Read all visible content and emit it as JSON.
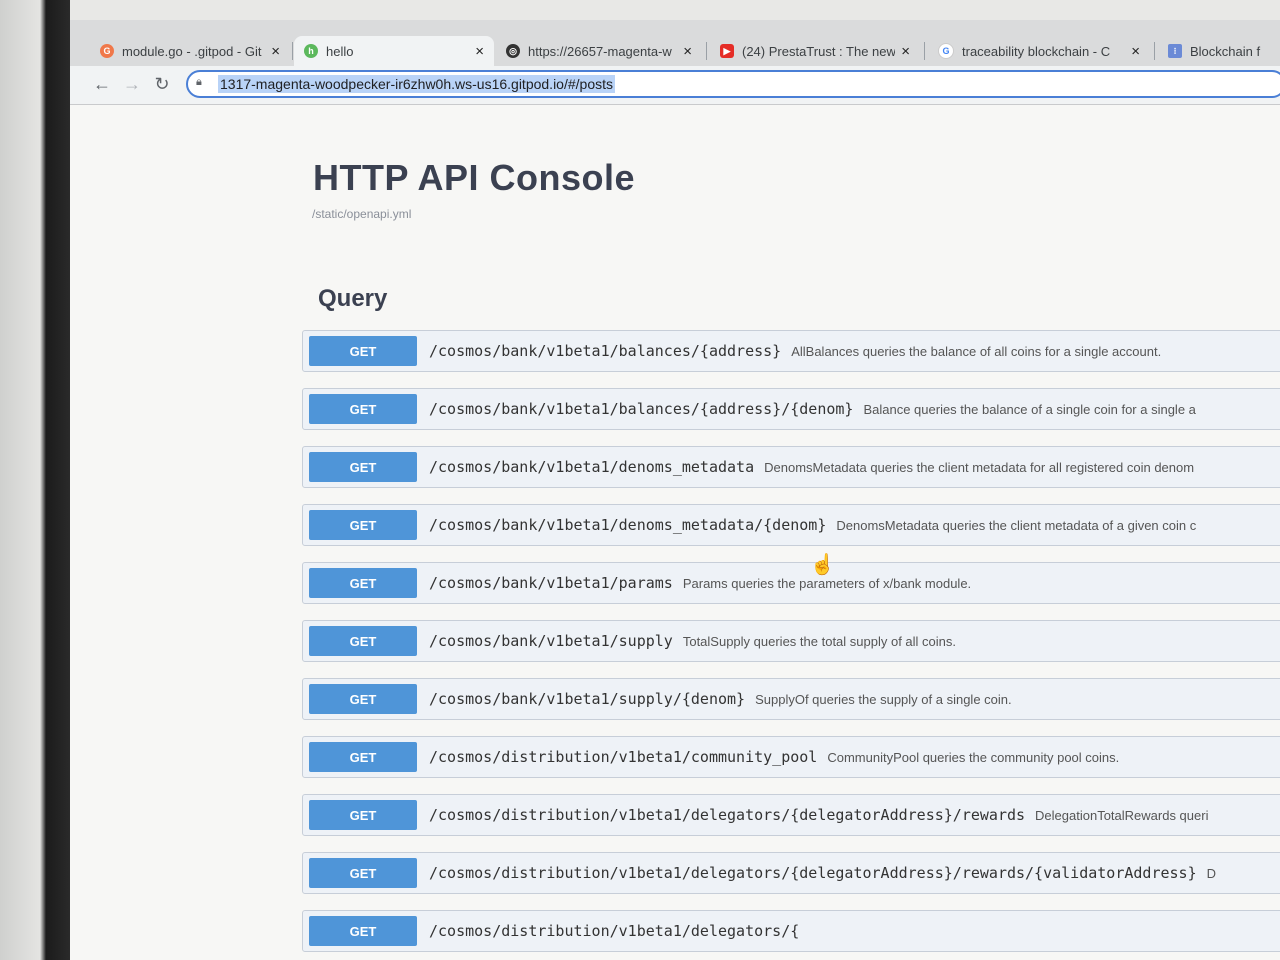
{
  "browser": {
    "tabs": [
      {
        "label": "module.go - .gitpod - Git",
        "favicon": "gitpod-icon",
        "color": "#f0784a"
      },
      {
        "label": "hello",
        "favicon": "app-icon",
        "color": "#5cb85c"
      },
      {
        "label": "https://26657-magenta-w",
        "favicon": "globe-icon",
        "color": "#333333"
      },
      {
        "label": "(24) PrestaTrust : The new",
        "favicon": "youtube-icon",
        "color": "#e52d27"
      },
      {
        "label": "traceability blockchain - C",
        "favicon": "google-icon",
        "color": "#4285f4"
      },
      {
        "label": "Blockchain f",
        "favicon": "grid-icon",
        "color": "#6b8ad6"
      }
    ],
    "close_glyph": "×",
    "url": "1317-magenta-woodpecker-ir6zhw0h.ws-us16.gitpod.io/#/posts"
  },
  "page": {
    "title": "HTTP API Console",
    "spec_link": "/static/openapi.yml",
    "section": "Query",
    "operations": [
      {
        "method": "GET",
        "path": "/cosmos/bank/v1beta1/balances/{address}",
        "description": "AllBalances queries the balance of all coins for a single account."
      },
      {
        "method": "GET",
        "path": "/cosmos/bank/v1beta1/balances/{address}/{denom}",
        "description": "Balance queries the balance of a single coin for a single a"
      },
      {
        "method": "GET",
        "path": "/cosmos/bank/v1beta1/denoms_metadata",
        "description": "DenomsMetadata queries the client metadata for all registered coin denom"
      },
      {
        "method": "GET",
        "path": "/cosmos/bank/v1beta1/denoms_metadata/{denom}",
        "description": "DenomsMetadata queries the client metadata of a given coin c"
      },
      {
        "method": "GET",
        "path": "/cosmos/bank/v1beta1/params",
        "description": "Params queries the parameters of x/bank module."
      },
      {
        "method": "GET",
        "path": "/cosmos/bank/v1beta1/supply",
        "description": "TotalSupply queries the total supply of all coins."
      },
      {
        "method": "GET",
        "path": "/cosmos/bank/v1beta1/supply/{denom}",
        "description": "SupplyOf queries the supply of a single coin."
      },
      {
        "method": "GET",
        "path": "/cosmos/distribution/v1beta1/community_pool",
        "description": "CommunityPool queries the community pool coins."
      },
      {
        "method": "GET",
        "path": "/cosmos/distribution/v1beta1/delegators/{delegatorAddress}/rewards",
        "description": "DelegationTotalRewards queri"
      },
      {
        "method": "GET",
        "path": "/cosmos/distribution/v1beta1/delegators/{delegatorAddress}/rewards/{validatorAddress}",
        "description": "D"
      },
      {
        "method": "GET",
        "path": "/cosmos/distribution/v1beta1/delegators/{",
        "description": ""
      }
    ]
  }
}
